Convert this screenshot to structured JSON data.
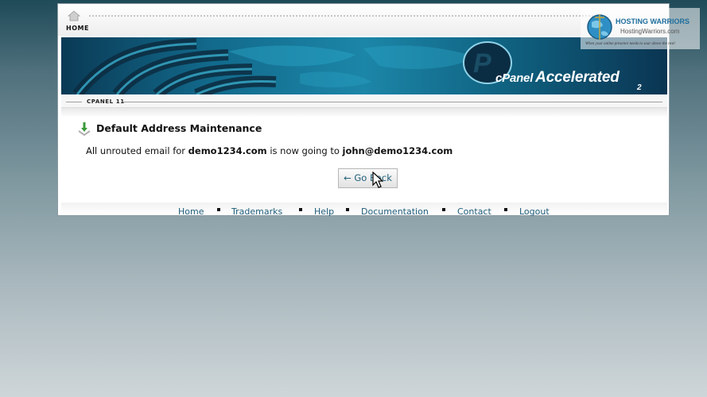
{
  "topnav": {
    "home_label": "HOME"
  },
  "banner": {
    "brand": "cPanel",
    "product": "Accelerated",
    "version_mark": "2"
  },
  "version_bar": {
    "label": "CPANEL 11"
  },
  "main": {
    "title": "Default Address Maintenance",
    "message_prefix": "All unrouted email for ",
    "domain": "demo1234.com",
    "message_middle": " is now going to ",
    "target": "john@demo1234.com",
    "go_back_label": "← Go Back"
  },
  "footer": {
    "links": [
      "Home",
      "Trademarks",
      "Help",
      "Documentation",
      "Contact",
      "Logout"
    ]
  },
  "watermark": {
    "title": "HOSTING WARRIORS",
    "site": "HostingWarriors.com",
    "tagline": "When your online presence needs to soar above the rest!"
  },
  "colors": {
    "link": "#1d5b78",
    "banner": "#126a8c",
    "background_top": "#1f4a58"
  }
}
